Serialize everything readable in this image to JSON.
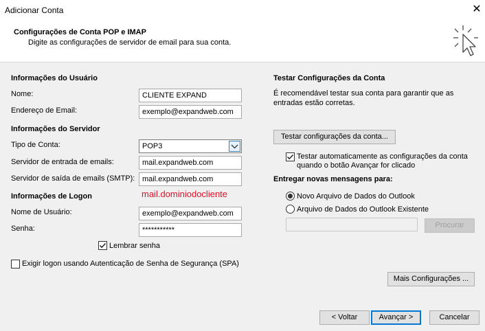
{
  "window": {
    "title": "Adicionar Conta"
  },
  "header": {
    "title": "Configurações de Conta POP e IMAP",
    "subtitle": "Digite as configurações de servidor de email para sua conta."
  },
  "user_info": {
    "section": "Informações do Usuário",
    "name_label": "Nome:",
    "name_value": "CLIENTE EXPAND",
    "email_label": "Endereço de Email:",
    "email_value": "exemplo@expandweb.com"
  },
  "server_info": {
    "section": "Informações do Servidor",
    "account_type_label": "Tipo de Conta:",
    "account_type_value": "POP3",
    "incoming_label": "Servidor de entrada de emails:",
    "incoming_value": "mail.expandweb.com",
    "outgoing_label": "Servidor de saída de emails (SMTP):",
    "outgoing_value": "mail.expandweb.com"
  },
  "logon_info": {
    "section": "Informações de Logon",
    "annotation": "mail.dominiodocliente",
    "username_label": "Nome de Usuário:",
    "username_value": "exemplo@expandweb.com",
    "password_label": "Senha:",
    "password_value": "***********",
    "remember_label": "Lembrar senha",
    "remember_checked": true,
    "spa_label": "Exigir logon usando Autenticação de Senha de Segurança (SPA)",
    "spa_checked": false
  },
  "test": {
    "section": "Testar Configurações da Conta",
    "description": "É recomendável testar sua conta para garantir que as entradas estão corretas.",
    "button_label": "Testar configurações da conta...",
    "auto_label": "Testar automaticamente as configurações da conta quando o botão Avançar for clicado",
    "auto_checked": true
  },
  "delivery": {
    "section": "Entregar novas mensagens para:",
    "option_new": "Novo Arquivo de Dados do Outlook",
    "option_existing": "Arquivo de Dados do Outlook Existente",
    "selected": "new",
    "browse_label": "Procurar",
    "path_value": ""
  },
  "more_settings_label": "Mais Configurações ...",
  "footer": {
    "back_label": "< Voltar",
    "next_label": "Avançar >",
    "cancel_label": "Cancelar"
  }
}
